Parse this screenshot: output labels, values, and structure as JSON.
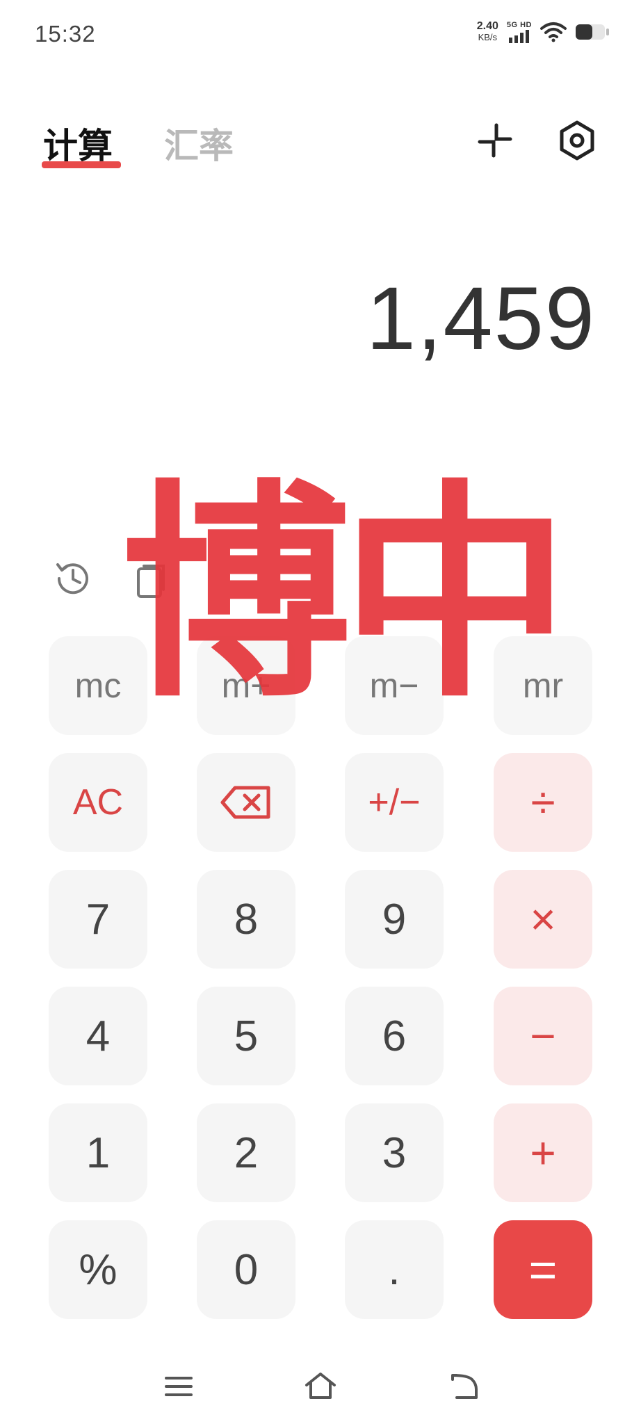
{
  "status": {
    "time": "15:32",
    "net_speed_value": "2.40",
    "net_speed_unit": "KB/s",
    "signal_label": "5G HD",
    "icons": [
      "signal-icon",
      "wifi-icon",
      "battery-icon"
    ]
  },
  "tabs": [
    {
      "label": "计算",
      "active": true
    },
    {
      "label": "汇率",
      "active": false
    }
  ],
  "toolbar_icons": [
    "compact-mode-icon",
    "settings-icon"
  ],
  "display": {
    "value": "1,459"
  },
  "watermark": "博中",
  "tools": [
    "history-icon",
    "copy-icon"
  ],
  "keys": [
    [
      "mc",
      "m+",
      "m−",
      "mr"
    ],
    [
      "AC",
      "backspace",
      "+/−",
      "÷"
    ],
    [
      "7",
      "8",
      "9",
      "×"
    ],
    [
      "4",
      "5",
      "6",
      "−"
    ],
    [
      "1",
      "2",
      "3",
      "+"
    ],
    [
      "%",
      "0",
      ".",
      "="
    ]
  ],
  "colors": {
    "accent": "#e84848",
    "operator_bg": "#fbe9e9",
    "key_bg": "#f5f5f5",
    "inactive_tab": "#b9b9b9"
  },
  "navbar_icons": [
    "menu-icon",
    "home-icon",
    "back-icon"
  ]
}
